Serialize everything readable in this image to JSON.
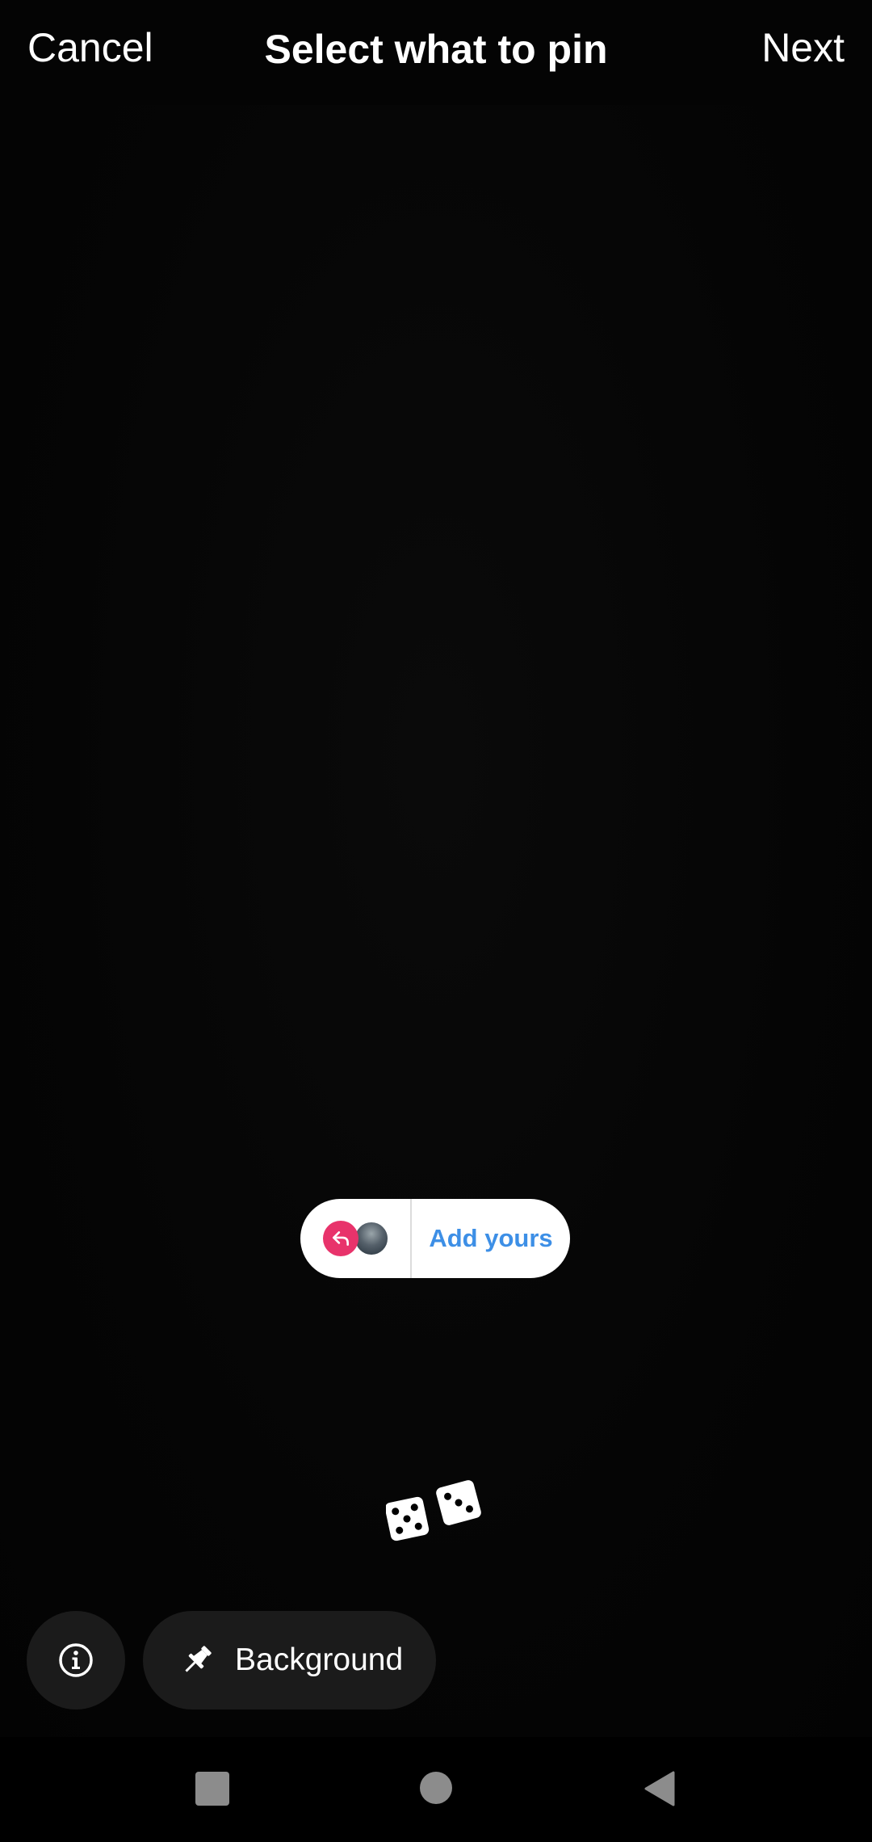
{
  "header": {
    "cancel_label": "Cancel",
    "title": "Select what to pin",
    "next_label": "Next"
  },
  "sticker": {
    "label": "Add yours",
    "icon": "reply-icon",
    "avatar": "user-avatar",
    "accent_color": "#e8336b",
    "label_color": "#3d8fe6"
  },
  "dice_sticker": {
    "icon": "dice-icon"
  },
  "bottom": {
    "info_icon": "info-icon",
    "background_label": "Background",
    "pin_icon": "pin-icon"
  },
  "navbar": {
    "recents_icon": "square-icon",
    "home_icon": "circle-icon",
    "back_icon": "back-triangle-icon"
  }
}
